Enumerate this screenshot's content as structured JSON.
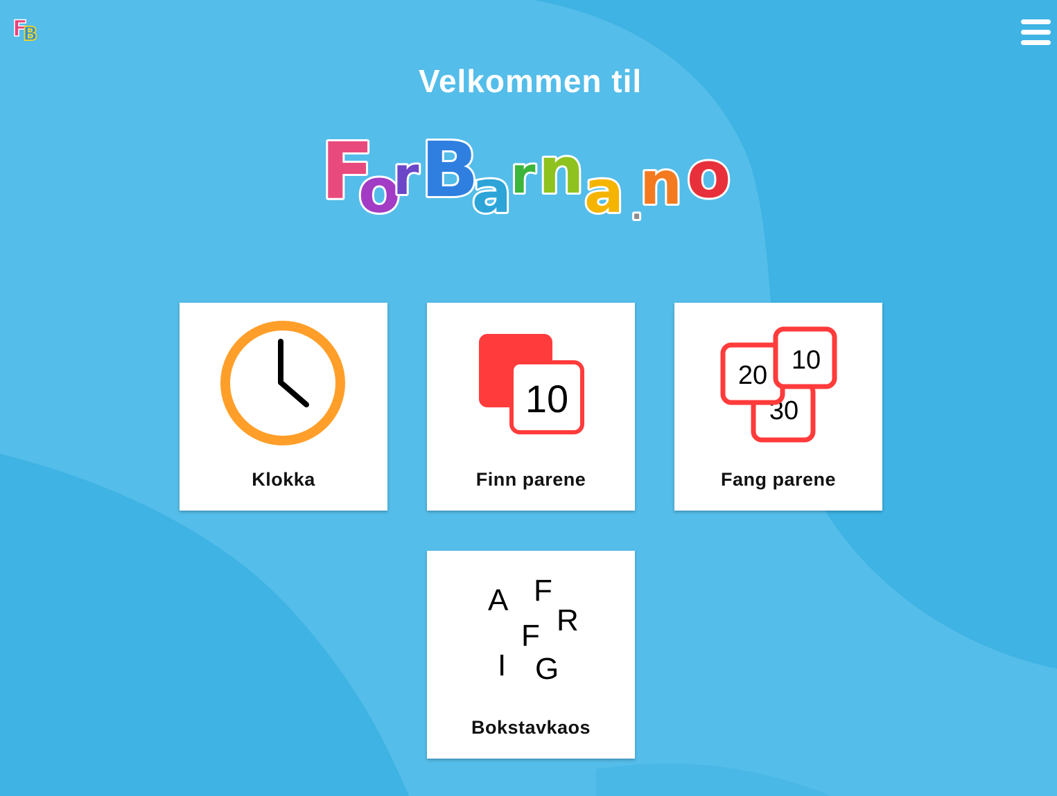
{
  "header": {
    "corner_logo": {
      "letters": [
        "F",
        "B"
      ],
      "colors": [
        "#e8417a",
        "#2c8fdc"
      ]
    },
    "menu_icon": "hamburger-menu-icon"
  },
  "welcome_text": "Velkommen til",
  "brand": {
    "logo_text": "ForBarna.no",
    "letters": [
      {
        "char": "F",
        "color": "#e94a7d"
      },
      {
        "char": "o",
        "color": "#a23cc4"
      },
      {
        "char": "r",
        "color": "#6b47c8"
      },
      {
        "char": "B",
        "color": "#2f7fe0"
      },
      {
        "char": "a",
        "color": "#2ca4d8"
      },
      {
        "char": "r",
        "color": "#3db43a"
      },
      {
        "char": "n",
        "color": "#8fc21f"
      },
      {
        "char": "a",
        "color": "#f5b400"
      },
      {
        "char": ".",
        "color": "#8d8d8d"
      },
      {
        "char": "n",
        "color": "#f47a20"
      },
      {
        "char": "o",
        "color": "#e8303a"
      }
    ]
  },
  "colors": {
    "background": "#54bde9",
    "wave": "#3fb3e3",
    "clock_ring": "#ff9f2a",
    "card_red": "#ff3b3b"
  },
  "tiles": [
    {
      "label": "Klokka",
      "icon": "clock-icon"
    },
    {
      "label": "Finn parene",
      "icon": "memory-cards-icon",
      "card_number": "10"
    },
    {
      "label": "Fang parene",
      "icon": "number-cards-icon",
      "numbers": [
        "20",
        "10",
        "30"
      ]
    },
    {
      "label": "Bokstavkaos",
      "icon": "scattered-letters-icon",
      "letters": [
        "A",
        "F",
        "R",
        "F",
        "I",
        "G"
      ]
    }
  ]
}
